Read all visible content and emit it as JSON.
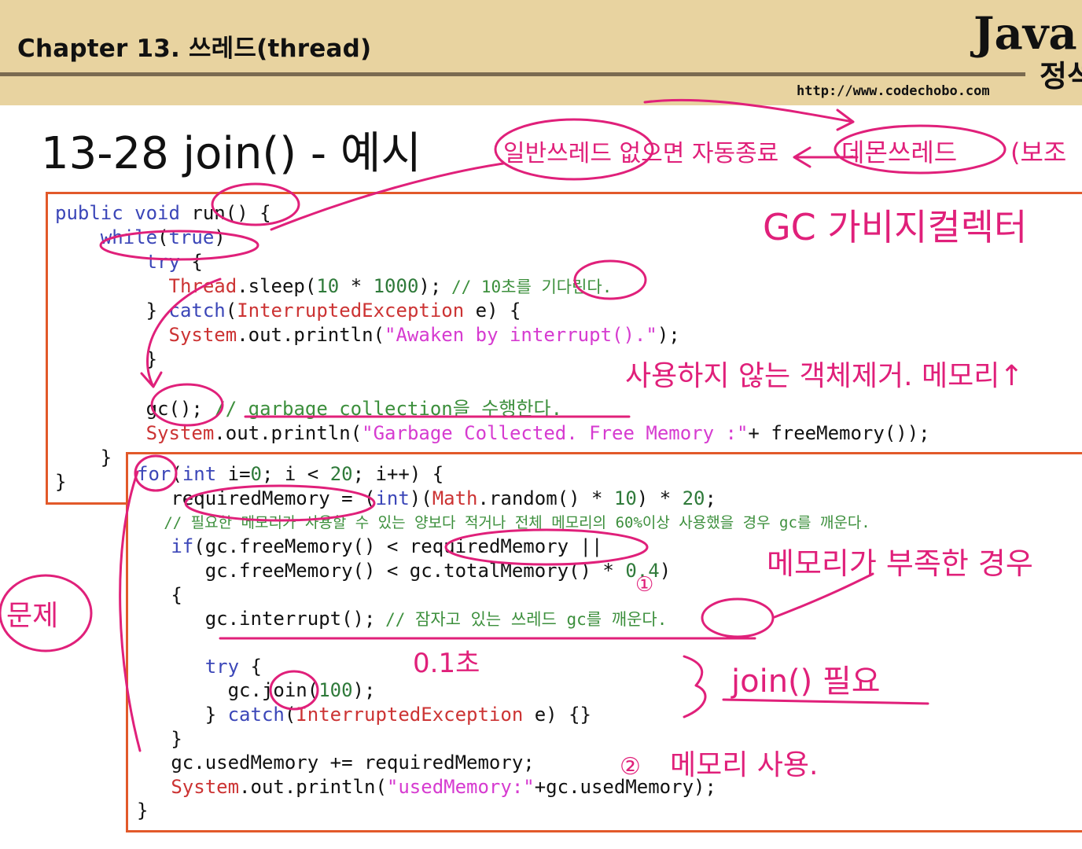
{
  "header": {
    "chapter_title": "Chapter 13. 쓰레드(thread)",
    "brand_main": "Java",
    "brand_sub": "정석",
    "url": "http://www.codechobo.com"
  },
  "slide": {
    "title": "13-28 join() - 예시"
  },
  "code": {
    "l1_a": "public void",
    "l1_b": " run() {",
    "l2_a": "    while",
    "l2_b": "(",
    "l2_c": "true",
    "l2_d": ")",
    "l3_a": "        try",
    "l3_b": " {",
    "l4_a": "          Thread",
    "l4_b": ".sleep(",
    "l4_c": "10",
    "l4_d": " * ",
    "l4_e": "1000",
    "l4_f": ");",
    "l4_cmt": " // 10초를 기다린다.",
    "l5_a": "        } ",
    "l5_b": "catch",
    "l5_c": "(",
    "l5_d": "InterruptedException",
    "l5_e": " e) {",
    "l6_a": "          System",
    "l6_b": ".out.println(",
    "l6_c": "\"Awaken by interrupt().\"",
    "l6_d": ");",
    "l7": "        }",
    "l8_a": "        gc();",
    "l8_cmt": " // garbage collection을 수행한다.",
    "l9_a": "        System",
    "l9_b": ".out.println(",
    "l9_c": "\"Garbage Collected. Free Memory :\"",
    "l9_d": "+ freeMemory());",
    "l10": "    }",
    "l11": "}",
    "m1_a": "for",
    "m1_b": "(",
    "m1_c": "int",
    "m1_d": " i=",
    "m1_e": "0",
    "m1_f": "; i < ",
    "m1_g": "20",
    "m1_h": "; i++) {",
    "m2_a": "   requiredMemory = (",
    "m2_b": "int",
    "m2_c": ")(",
    "m2_d": "Math",
    "m2_e": ".random() * ",
    "m2_f": "10",
    "m2_g": ") * ",
    "m2_h": "20",
    "m2_i": ";",
    "m3_cmt": "   // 필요한 메모리가 사용할 수 있는 양보다 적거나 전체 메모리의 60%이상 사용했을 경우 gc를 깨운다.",
    "m4_a": "   ",
    "m4_b": "if",
    "m4_c": "(gc.freeMemory() < requiredMemory ||",
    "m5_a": "      gc.freeMemory() < gc.totalMemory() * ",
    "m5_b": "0.4",
    "m5_c": ")",
    "m6": "   {",
    "m7_a": "      gc.interrupt();",
    "m7_cmt": " // 잠자고 있는 쓰레드 gc를 깨운다.",
    "m8_a": "      try",
    "m8_b": " {",
    "m9_a": "        gc.join(",
    "m9_b": "100",
    "m9_c": ");",
    "m10_a": "      } ",
    "m10_b": "catch",
    "m10_c": "(",
    "m10_d": "InterruptedException",
    "m10_e": " e) {}",
    "m11": "   }",
    "m12": "   gc.usedMemory += requiredMemory;",
    "m13_a": "   System",
    "m13_b": ".out.println(",
    "m13_c": "\"usedMemory:\"",
    "m13_d": "+gc.usedMemory);",
    "m14": "}"
  },
  "annotations": {
    "daemon_note": "일반쓰레드 없으면 자동종료",
    "daemon": "데몬쓰레드",
    "daemon_paren": "(보조",
    "gc_note": "GC 가비지컬렉터",
    "cleanup_note": "사용하지 않는 객체제거. 메모리↑",
    "problem": "문제",
    "low_mem": "메모리가 부족한 경우",
    "point1": "①",
    "point2": "②",
    "sec_note": "0.1초",
    "join_note": "join() 필요",
    "use_mem": "메모리 사용."
  },
  "colors": {
    "header_bg": "#e8d3a0",
    "box_border": "#e2592a",
    "ink": "#e0207a",
    "keyword": "#3b46b8",
    "string": "#d63bd0",
    "class": "#cc3333",
    "comment": "#3c8f3c"
  }
}
